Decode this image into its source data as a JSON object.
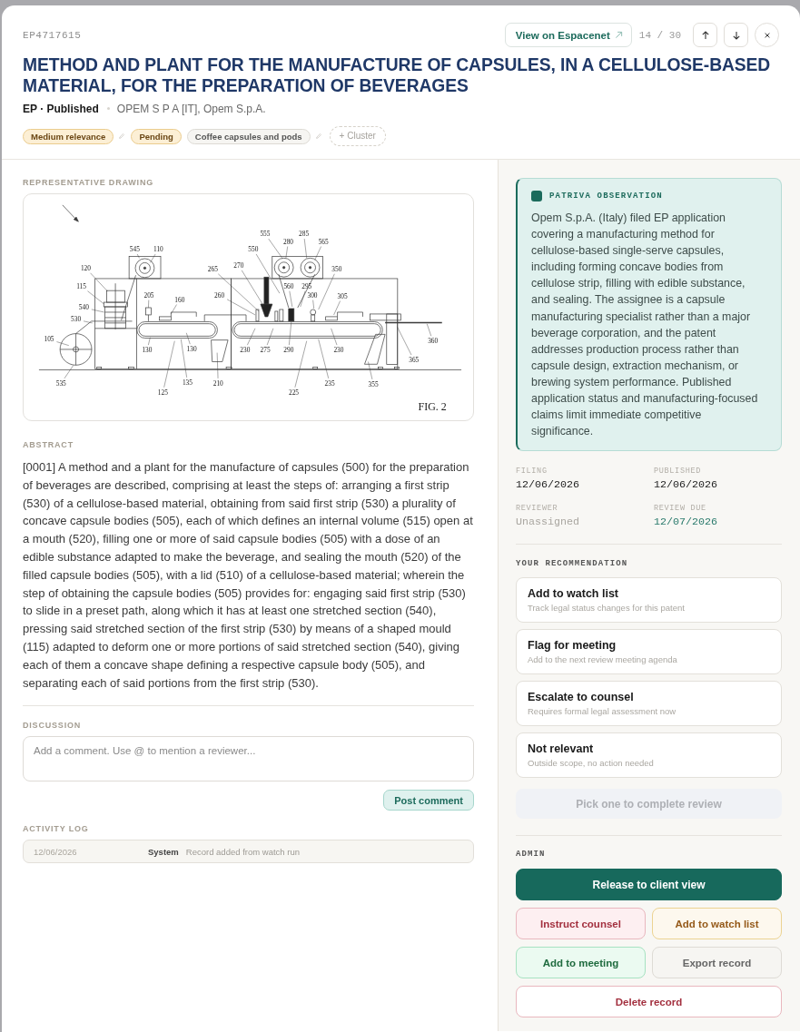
{
  "header": {
    "record_id": "EP4717615",
    "espacenet_button": "View on Espacenet",
    "position": "14 / 30",
    "title": "METHOD AND PLANT FOR THE MANUFACTURE OF CAPSULES, IN A CELLULOSE-BASED MATERIAL, FOR THE PREPARATION OF BEVERAGES",
    "jurisdiction_status": "EP · Published",
    "applicants": "OPEM S P A [IT], Opem S.p.A.",
    "tags": [
      {
        "label": "Medium relevance",
        "kind": "relevance",
        "editable": true
      },
      {
        "label": "Pending",
        "kind": "status",
        "editable": false
      },
      {
        "label": "Coffee capsules and pods",
        "kind": "category",
        "editable": true
      },
      {
        "label": "+ Cluster",
        "kind": "add",
        "editable": false
      }
    ]
  },
  "drawing": {
    "label": "REPRESENTATIVE DRAWING",
    "reference_numbers": [
      "555",
      "285",
      "280",
      "565",
      "545",
      "110",
      "550",
      "120",
      "265",
      "270",
      "350",
      "115",
      "560",
      "295",
      "205",
      "160",
      "260",
      "300",
      "305",
      "540",
      "530",
      "105",
      "360",
      "130",
      "130",
      "230",
      "275",
      "290",
      "230",
      "365",
      "535",
      "135",
      "210",
      "235",
      "355",
      "125",
      "225"
    ],
    "caption": "FIG. 2"
  },
  "abstract": {
    "label": "ABSTRACT",
    "text": "[0001] A method and a plant for the manufacture of capsules (500) for the preparation of beverages are described, comprising at least the steps of: arranging a first strip (530) of a cellulose-based material, obtaining from said first strip (530) a plurality of concave capsule bodies (505), each of which defines an internal volume (515) open at a mouth (520), filling one or more of said capsule bodies (505) with a dose of an edible substance adapted to make the beverage, and sealing the mouth (520) of the filled capsule bodies (505), with a lid (510) of a cellulose-based material; wherein the step of obtaining the capsule bodies (505) provides for: engaging said first strip (530) to slide in a preset path, along which it has at least one stretched section (540), pressing said stretched section of the first strip (530) by means of a shaped mould (115) adapted to deform one or more portions of said stretched section (540), giving each of them a concave shape defining a respective capsule body (505), and separating each of said portions from the first strip (530)."
  },
  "discussion": {
    "label": "DISCUSSION",
    "placeholder": "Add a comment. Use @ to mention a reviewer...",
    "post_button": "Post comment"
  },
  "activity_log": {
    "label": "ACTIVITY LOG",
    "entries": [
      {
        "date": "12/06/2026",
        "actor": "System",
        "event": "Record added from watch run"
      }
    ]
  },
  "observation": {
    "title": "PATRIVA OBSERVATION",
    "text": "Opem S.p.A. (Italy) filed EP application covering a manufacturing method for cellulose-based single-serve capsules, including forming concave bodies from cellulose strip, filling with edible substance, and sealing. The assignee is a capsule manufacturing specialist rather than a major beverage corporation, and the patent addresses production process rather than capsule design, extraction mechanism, or brewing system performance. Published application status and manufacturing-focused claims limit immediate competitive significance."
  },
  "details": [
    {
      "label": "FILING",
      "value": "12/06/2026",
      "kind": "date"
    },
    {
      "label": "PUBLISHED",
      "value": "12/06/2026",
      "kind": "date"
    },
    {
      "label": "REVIEWER",
      "value": "Unassigned",
      "kind": "empty"
    },
    {
      "label": "REVIEW DUE",
      "value": "12/07/2026",
      "kind": "due"
    }
  ],
  "recommendation": {
    "label": "YOUR RECOMMENDATION",
    "options": [
      {
        "title": "Add to watch list",
        "description": "Track legal status changes for this patent",
        "selected": false
      },
      {
        "title": "Flag for meeting",
        "description": "Add to the next review meeting agenda",
        "selected": false
      },
      {
        "title": "Escalate to counsel",
        "description": "Requires formal legal assessment now",
        "selected": false
      },
      {
        "title": "Not relevant",
        "description": "Outside scope, no action needed",
        "selected": false
      }
    ],
    "complete_button": {
      "label": "Pick one to complete review",
      "disabled": true
    }
  },
  "admin": {
    "label": "ADMIN",
    "actions": [
      {
        "label": "Release to client view",
        "kind": "primary"
      },
      {
        "label": "Instruct counsel",
        "kind": "danger"
      },
      {
        "label": "Add to watch list",
        "kind": "warning"
      },
      {
        "label": "Add to meeting",
        "kind": "success"
      },
      {
        "label": "Export record",
        "kind": "neutral"
      },
      {
        "label": "Delete record",
        "kind": "delete"
      }
    ]
  }
}
